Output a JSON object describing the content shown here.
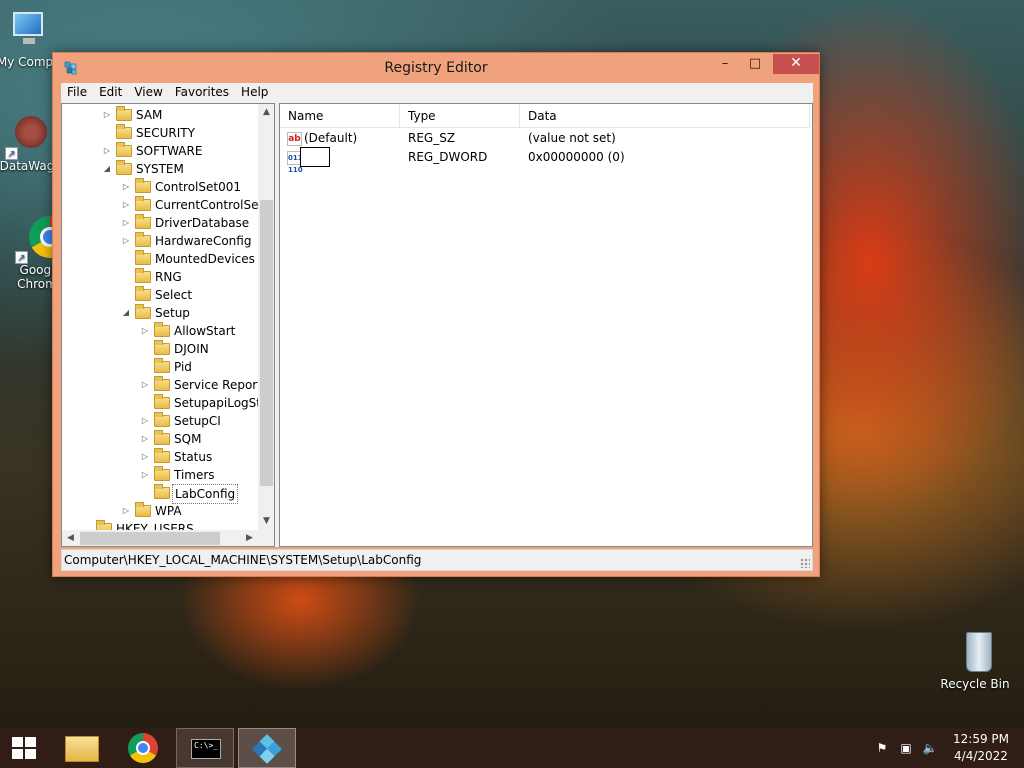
{
  "desktop": {
    "icons": {
      "my_computer": "My Comp",
      "datawag": "DataWag",
      "chrome_line1": "Googl",
      "chrome_line2": "Chrom",
      "recycle_bin": "Recycle Bin"
    }
  },
  "window": {
    "title": "Registry Editor",
    "controls": {
      "minimize": "–",
      "maximize": "□",
      "close": "✕"
    }
  },
  "menu": [
    "File",
    "Edit",
    "View",
    "Favorites",
    "Help"
  ],
  "tree": {
    "items": [
      {
        "label": "SAM",
        "expander": "▷"
      },
      {
        "label": "SECURITY",
        "expander": ""
      },
      {
        "label": "SOFTWARE",
        "expander": "▷"
      },
      {
        "label": "SYSTEM",
        "expander": "◢"
      },
      {
        "label": "ControlSet001",
        "expander": "▷"
      },
      {
        "label": "CurrentControlSet",
        "expander": "▷"
      },
      {
        "label": "DriverDatabase",
        "expander": "▷"
      },
      {
        "label": "HardwareConfig",
        "expander": "▷"
      },
      {
        "label": "MountedDevices",
        "expander": ""
      },
      {
        "label": "RNG",
        "expander": ""
      },
      {
        "label": "Select",
        "expander": ""
      },
      {
        "label": "Setup",
        "expander": "◢"
      },
      {
        "label": "AllowStart",
        "expander": "▷"
      },
      {
        "label": "DJOIN",
        "expander": ""
      },
      {
        "label": "Pid",
        "expander": ""
      },
      {
        "label": "Service Reportir",
        "expander": "▷"
      },
      {
        "label": "SetupapiLogStat",
        "expander": ""
      },
      {
        "label": "SetupCI",
        "expander": "▷"
      },
      {
        "label": "SQM",
        "expander": "▷"
      },
      {
        "label": "Status",
        "expander": "▷"
      },
      {
        "label": "Timers",
        "expander": "▷"
      },
      {
        "label": "LabConfig",
        "expander": ""
      },
      {
        "label": "WPA",
        "expander": "▷"
      },
      {
        "label": "HKEY_USERS",
        "expander": ""
      }
    ]
  },
  "list": {
    "columns": [
      "Name",
      "Type",
      "Data"
    ],
    "rows": [
      {
        "icon": "ab",
        "name": "(Default)",
        "type": "REG_SZ",
        "data": "(value not set)"
      },
      {
        "icon": "011 110",
        "name": "",
        "type": "REG_DWORD",
        "data": "0x00000000 (0)"
      }
    ]
  },
  "status": {
    "path": "Computer\\HKEY_LOCAL_MACHINE\\SYSTEM\\Setup\\LabConfig"
  },
  "taskbar": {
    "cmd_text": "C:\\>_",
    "time": "12:59 PM",
    "date": "4/4/2022"
  },
  "icons": {
    "start": "windows-logo-icon",
    "explorer": "folder-icon",
    "chrome": "chrome-icon",
    "cmd": "command-prompt-icon",
    "regedit": "registry-editor-icon",
    "tray_flag": "action-center-flag-icon",
    "tray_network": "network-icon",
    "tray_volume": "volume-muted-icon"
  },
  "colors": {
    "title_bar": "#f0a27c",
    "close_button": "#c75050",
    "taskbar": "#32201a"
  }
}
